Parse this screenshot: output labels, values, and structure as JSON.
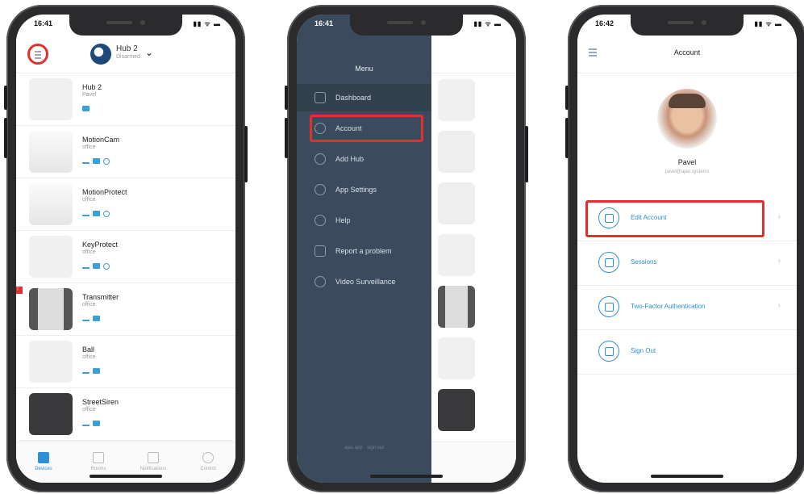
{
  "status": {
    "time1": "16:41",
    "time2": "16:41",
    "time3": "16:42",
    "icons": "▮▮ ᯤ ▬"
  },
  "phone1": {
    "hub": {
      "name": "Hub 2",
      "status": "Disarmed"
    },
    "devices": [
      {
        "name": "Hub 2",
        "room": "Pavel",
        "alert": ""
      },
      {
        "name": "MotionCam",
        "room": "office",
        "alert": ""
      },
      {
        "name": "MotionProtect",
        "room": "office",
        "alert": ""
      },
      {
        "name": "KeyProtect",
        "room": "office",
        "alert": ""
      },
      {
        "name": "Transmitter",
        "room": "office",
        "alert": "!"
      },
      {
        "name": "Ball",
        "room": "office",
        "alert": ""
      },
      {
        "name": "StreetSiren",
        "room": "office",
        "alert": ""
      }
    ],
    "tabs": [
      "Devices",
      "Rooms",
      "Notifications",
      "Control"
    ]
  },
  "phone2": {
    "menu_title": "Menu",
    "items": [
      "Dashboard",
      "Account",
      "Add Hub",
      "App Settings",
      "Help",
      "Report a problem",
      "Video Surveillance"
    ],
    "footer": "ajax.app · sign out"
  },
  "phone3": {
    "title": "Account",
    "user_name": "Pavel",
    "user_email": "pavel@ajax.systems",
    "rows": [
      "Edit Account",
      "Sessions",
      "Two-Factor Authentication",
      "Sign Out"
    ]
  },
  "colors": {
    "accent": "#2f8fd6",
    "highlight": "#e0302f",
    "menu_bg": "#3b4a5c"
  }
}
